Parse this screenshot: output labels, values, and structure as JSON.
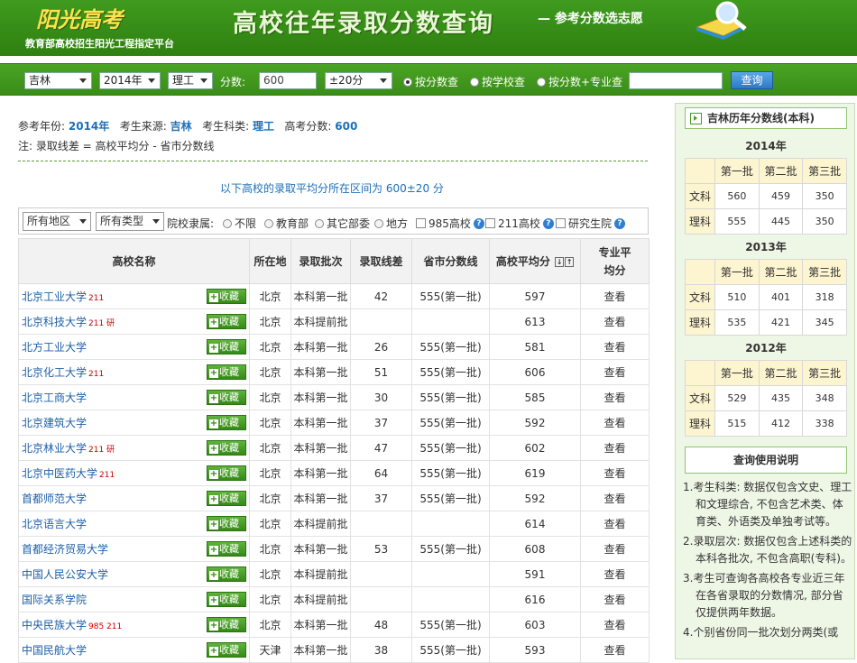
{
  "banner": {
    "logo": "阳光高考",
    "logo_sub": "教育部高校招生阳光工程指定平台",
    "title": "高校往年录取分数查询",
    "subtitle": "— 参考分数选志愿"
  },
  "search": {
    "province": "吉林",
    "year": "2014年",
    "subject": "理工",
    "score_label": "分数:",
    "score_value": "600",
    "range": "±20分",
    "radio1": "按分数查",
    "radio2": "按学校查",
    "radio3": "按分数+专业查",
    "query_button": "查询"
  },
  "info": {
    "year_label": "参考年份:",
    "year": "2014年",
    "source_label": "考生来源:",
    "source": "吉林",
    "type_label": "考生科类:",
    "type": "理工",
    "score_label": "高考分数:",
    "score": "600",
    "note": "注: 录取线差 = 高校平均分 - 省市分数线",
    "range_prefix": "以下高校的录取平均分所在区间为",
    "range_value": "600±20",
    "range_suffix": "分"
  },
  "filter": {
    "region": "所有地区",
    "type": "所有类型",
    "affiliation_label": "院校隶属:",
    "opt1": "不限",
    "opt2": "教育部",
    "opt3": "其它部委",
    "opt4": "地方",
    "chk1": "985高校",
    "chk2": "211高校",
    "chk3": "研究生院"
  },
  "table": {
    "headers": [
      "高校名称",
      "所在地",
      "录取批次",
      "录取线差",
      "省市分数线",
      "高校平均分",
      "专业平均分"
    ],
    "fav_label": "收藏",
    "view_label": "查看",
    "rows": [
      {
        "name": "北京工业大学",
        "tag": "211",
        "loc": "北京",
        "batch": "本科第一批",
        "diff": "42",
        "line": "555(第一批)",
        "avg": "597"
      },
      {
        "name": "北京科技大学",
        "tag": "211 研",
        "loc": "北京",
        "batch": "本科提前批",
        "diff": "",
        "line": "",
        "avg": "613"
      },
      {
        "name": "北方工业大学",
        "tag": "",
        "loc": "北京",
        "batch": "本科第一批",
        "diff": "26",
        "line": "555(第一批)",
        "avg": "581"
      },
      {
        "name": "北京化工大学",
        "tag": "211",
        "loc": "北京",
        "batch": "本科第一批",
        "diff": "51",
        "line": "555(第一批)",
        "avg": "606"
      },
      {
        "name": "北京工商大学",
        "tag": "",
        "loc": "北京",
        "batch": "本科第一批",
        "diff": "30",
        "line": "555(第一批)",
        "avg": "585"
      },
      {
        "name": "北京建筑大学",
        "tag": "",
        "loc": "北京",
        "batch": "本科第一批",
        "diff": "37",
        "line": "555(第一批)",
        "avg": "592"
      },
      {
        "name": "北京林业大学",
        "tag": "211 研",
        "loc": "北京",
        "batch": "本科第一批",
        "diff": "47",
        "line": "555(第一批)",
        "avg": "602"
      },
      {
        "name": "北京中医药大学",
        "tag": "211",
        "loc": "北京",
        "batch": "本科第一批",
        "diff": "64",
        "line": "555(第一批)",
        "avg": "619"
      },
      {
        "name": "首都师范大学",
        "tag": "",
        "loc": "北京",
        "batch": "本科第一批",
        "diff": "37",
        "line": "555(第一批)",
        "avg": "592"
      },
      {
        "name": "北京语言大学",
        "tag": "",
        "loc": "北京",
        "batch": "本科提前批",
        "diff": "",
        "line": "",
        "avg": "614"
      },
      {
        "name": "首都经济贸易大学",
        "tag": "",
        "loc": "北京",
        "batch": "本科第一批",
        "diff": "53",
        "line": "555(第一批)",
        "avg": "608"
      },
      {
        "name": "中国人民公安大学",
        "tag": "",
        "loc": "北京",
        "batch": "本科提前批",
        "diff": "",
        "line": "",
        "avg": "591"
      },
      {
        "name": "国际关系学院",
        "tag": "",
        "loc": "北京",
        "batch": "本科提前批",
        "diff": "",
        "line": "",
        "avg": "616"
      },
      {
        "name": "中央民族大学",
        "tag": "985 211",
        "loc": "北京",
        "batch": "本科第一批",
        "diff": "48",
        "line": "555(第一批)",
        "avg": "603"
      },
      {
        "name": "中国民航大学",
        "tag": "",
        "loc": "天津",
        "batch": "本科第一批",
        "diff": "38",
        "line": "555(第一批)",
        "avg": "593"
      }
    ]
  },
  "sidebar": {
    "title": "吉林历年分数线(本科)",
    "cols": [
      "第一批",
      "第二批",
      "第三批"
    ],
    "years": [
      {
        "year": "2014年",
        "rows": [
          {
            "label": "文科",
            "v": [
              "560",
              "459",
              "350"
            ]
          },
          {
            "label": "理科",
            "v": [
              "555",
              "445",
              "350"
            ]
          }
        ]
      },
      {
        "year": "2013年",
        "rows": [
          {
            "label": "文科",
            "v": [
              "510",
              "401",
              "318"
            ]
          },
          {
            "label": "理科",
            "v": [
              "535",
              "421",
              "345"
            ]
          }
        ]
      },
      {
        "year": "2012年",
        "rows": [
          {
            "label": "文科",
            "v": [
              "529",
              "435",
              "348"
            ]
          },
          {
            "label": "理科",
            "v": [
              "515",
              "412",
              "338"
            ]
          }
        ]
      }
    ],
    "howto_title": "查询使用说明",
    "tips": [
      "1.考生科类: 数据仅包含文史、理工和文理综合, 不包含艺术类、体育类、外语类及单独考试等。",
      "2.录取层次: 数据仅包含上述科类的本科各批次, 不包含高职(专科)。",
      "3.考生可查询各高校各专业近三年在各省录取的分数情况, 部分省仅提供两年数据。",
      "4.个别省份同一批次划分两类(或"
    ]
  }
}
